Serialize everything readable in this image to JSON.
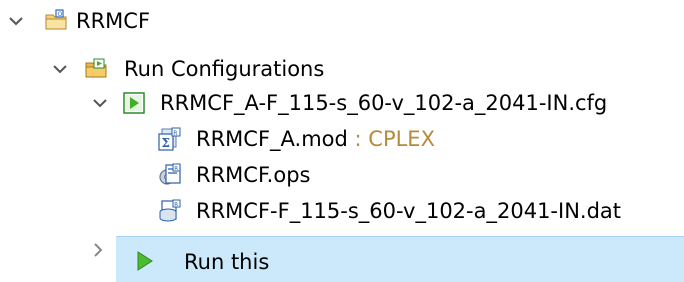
{
  "tree": {
    "project": {
      "label": "RRMCF"
    },
    "run_configurations": {
      "label": "Run Configurations"
    },
    "config_file": {
      "label": "RRMCF_A-F_115-s_60-v_102-a_2041-IN.cfg"
    },
    "children": [
      {
        "label": "RRMCF_A.mod",
        "decoration": " : CPLEX",
        "icon": "model-file-icon"
      },
      {
        "label": "RRMCF.ops",
        "icon": "settings-file-icon"
      },
      {
        "label": "RRMCF-F_115-s_60-v_102-a_2041-IN.dat",
        "icon": "data-file-icon"
      }
    ]
  },
  "context_menu": {
    "run_label": "Run this",
    "run_icon": "run-icon"
  },
  "colors": {
    "selection_bg": "#cce8fb",
    "decoration_text": "#b58a3a",
    "run_green": "#3fae2a",
    "folder_yellow": "#e8b84a"
  }
}
